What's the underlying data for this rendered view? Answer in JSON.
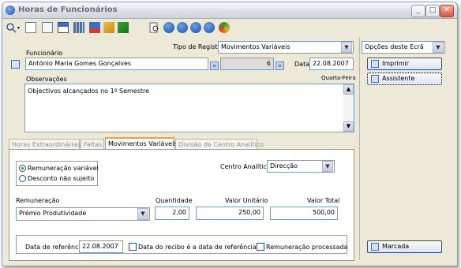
{
  "window": {
    "title": "Horas de Funcionários"
  },
  "toolbar": {
    "icons": [
      "search-icon",
      "new-doc-icon",
      "copy-icon",
      "properties-icon",
      "grid-icon",
      "delete-icon",
      "export-icon",
      "preview-icon",
      "first-icon",
      "prev-icon",
      "next-icon",
      "last-icon",
      "refresh-icon"
    ]
  },
  "header": {
    "tipo_label": "Tipo de Registo",
    "tipo_value": "Movimentos Variáveis",
    "funcionario_label": "Funcionário",
    "funcionario_value": "António Maria Gomes Gonçalves",
    "numero_value": "6",
    "data_label": "Data",
    "data_value": "22.08.2007",
    "weekday": "Quarta-Feira",
    "obs_label": "Observações",
    "obs_value": "Objectivos alcançados no 1º Semestre"
  },
  "tabs": [
    {
      "label": "Horas Extraordinárias"
    },
    {
      "label": "Faltas"
    },
    {
      "label": "Movimentos Variáveis"
    },
    {
      "label": "Divisão de Centro Analítico"
    }
  ],
  "panel": {
    "radio_variavel": "Remuneração variável",
    "radio_desconto": "Desconto não sujeito",
    "centro_label": "Centro Analítico",
    "centro_value": "Direcção",
    "remuneracao_label": "Remuneração",
    "remuneracao_value": "Prémio Produtividade",
    "quantidade_label": "Quantidade",
    "quantidade_value": "2,00",
    "valor_unitario_label": "Valor Unitário",
    "valor_unitario_value": "250,00",
    "valor_total_label": "Valor Total",
    "valor_total_value": "500,00",
    "data_ref_label": "Data de referência",
    "data_ref_value": "22.08.2007",
    "check_recibo": "Data do recibo é a data de referência",
    "check_processada": "Remuneração processada"
  },
  "sidebar": {
    "options_value": "Opções deste Ecrã",
    "imprimir": "Imprimir",
    "assistente": "Assistente",
    "marcada": "Marcada"
  }
}
